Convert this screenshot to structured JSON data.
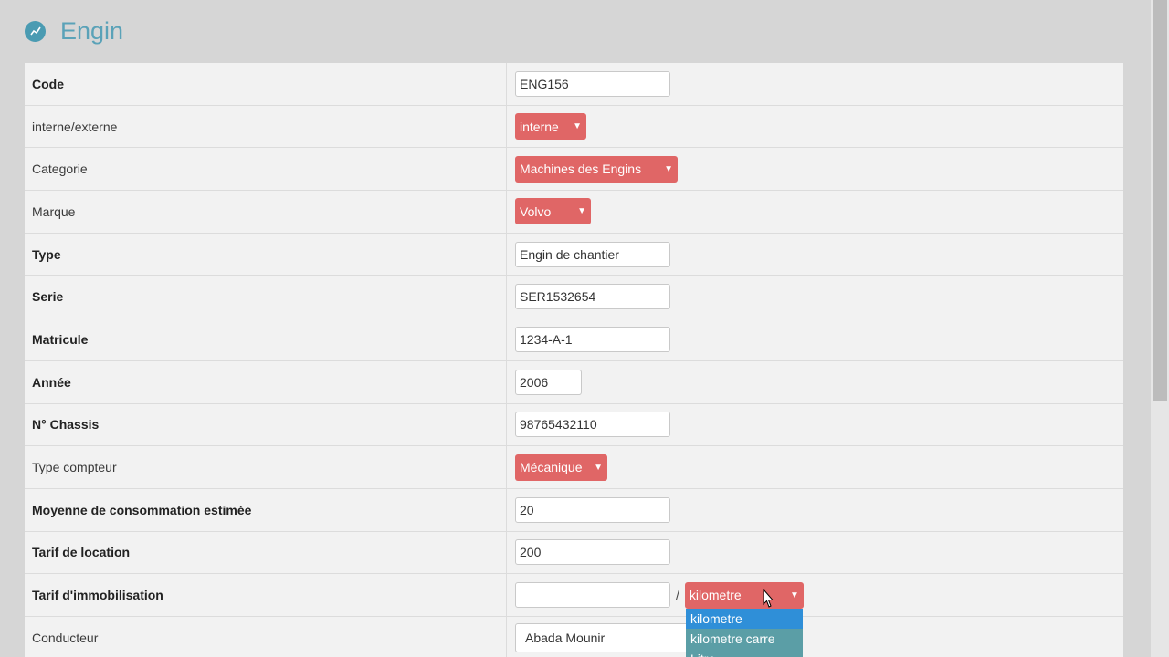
{
  "header": {
    "title": "Engin",
    "icon": "chart-icon"
  },
  "form": {
    "code": {
      "label": "Code",
      "value": "ENG156"
    },
    "interne_externe": {
      "label": "interne/externe",
      "selected": "interne"
    },
    "categorie": {
      "label": "Categorie",
      "selected": "Machines des Engins"
    },
    "marque": {
      "label": "Marque",
      "selected": "Volvo"
    },
    "type": {
      "label": "Type",
      "value": "Engin de chantier"
    },
    "serie": {
      "label": "Serie",
      "value": "SER1532654"
    },
    "matricule": {
      "label": "Matricule",
      "value": "1234-A-1"
    },
    "annee": {
      "label": "Année",
      "value": "2006"
    },
    "chassis": {
      "label": "N° Chassis",
      "value": "98765432110"
    },
    "type_compteur": {
      "label": "Type compteur",
      "selected": "Mécanique"
    },
    "moyenne": {
      "label": "Moyenne de consommation estimée",
      "value": "20"
    },
    "tarif_location": {
      "label": "Tarif de location",
      "value": "200"
    },
    "tarif_immobilisation": {
      "label": "Tarif d'immobilisation",
      "value": "",
      "separator": "/",
      "unit_selected": "kilometre",
      "unit_options": [
        "kilometre",
        "kilometre carre",
        "Litre"
      ]
    },
    "conducteur": {
      "label": "Conducteur",
      "selected": "Abada Mounir"
    }
  },
  "colors": {
    "accent": "#e06666",
    "title": "#5aa2b8",
    "option_active": "#2f8fd8",
    "option_normal": "#5b9ea6"
  }
}
